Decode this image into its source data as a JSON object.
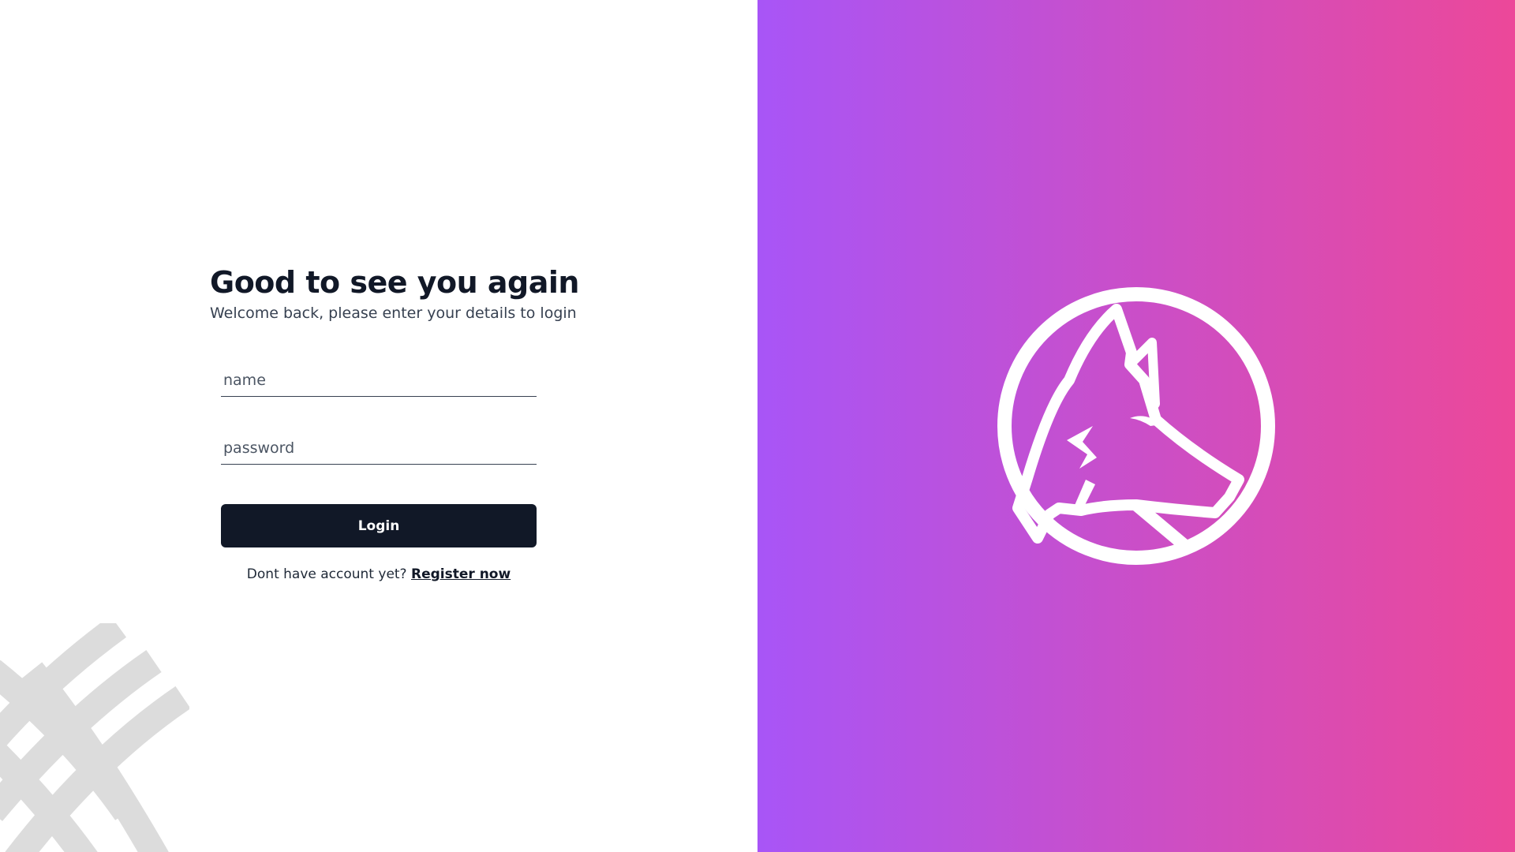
{
  "login": {
    "title": "Good to see you again",
    "subtitle": "Welcome back, please enter your details to login",
    "name_placeholder": "name",
    "password_placeholder": "password",
    "login_label": "Login",
    "register_prompt": "Dont have account yet?",
    "register_link": "Register now"
  },
  "decor": {
    "icon": "crosshatch-pattern-icon"
  },
  "brand": {
    "logo_icon": "fox-logo-icon",
    "gradient_start": "#a855f7",
    "gradient_end": "#ec4899"
  },
  "colors": {
    "button_background": "#111827",
    "title_text": "#111827",
    "decor_gray": "#dcdcdc"
  }
}
